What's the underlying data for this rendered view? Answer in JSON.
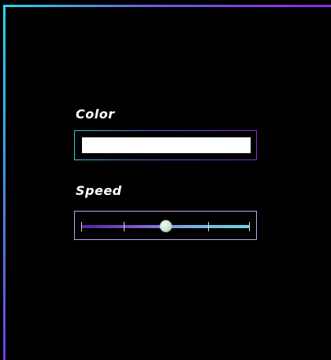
{
  "form": {
    "color": {
      "label": "Color",
      "value": "#ffffff"
    },
    "speed": {
      "label": "Speed",
      "value_fraction": 0.5,
      "tick_count": 5
    }
  },
  "theme": {
    "background": "#000000",
    "accent_cyan": "#27d7e8",
    "accent_purple": "#8a2bd6",
    "text": "#ffffff"
  }
}
